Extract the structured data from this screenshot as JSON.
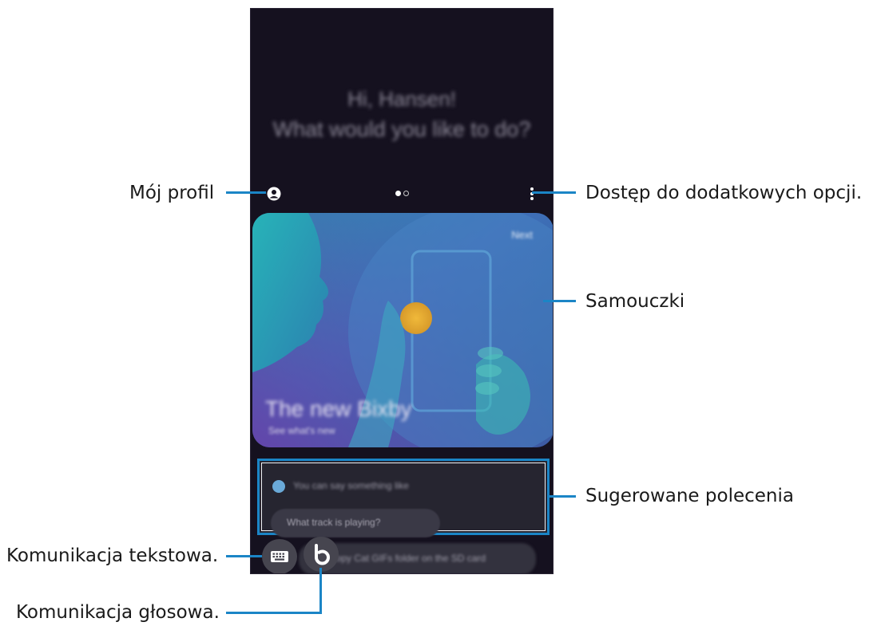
{
  "callouts": {
    "profile": "Mój profil",
    "more_options": "Dostęp do dodatkowych opcji.",
    "tutorials": "Samouczki",
    "suggested": "Sugerowane polecenia",
    "text_input": "Komunikacja tekstowa.",
    "voice_input": "Komunikacja głosowa."
  },
  "screen": {
    "greeting_line1": "Hi, Hansen!",
    "greeting_line2": "What would you like to do?",
    "pager": {
      "pages": 2,
      "active": 1
    },
    "card": {
      "next_label": "Next",
      "title": "The new Bixby",
      "subtitle": "See what's new"
    },
    "suggestions": {
      "heading": "You can say something like",
      "chip": "What track is playing?"
    },
    "bottom_chip": "Copy Cat GIFs folder on the SD card"
  },
  "colors": {
    "accent_line": "#1b85c6",
    "screen_bg": "#15111f"
  },
  "icons": {
    "profile": "profile-icon",
    "more": "more-vertical-icon",
    "keyboard": "keyboard-icon",
    "bixby": "bixby-icon"
  }
}
